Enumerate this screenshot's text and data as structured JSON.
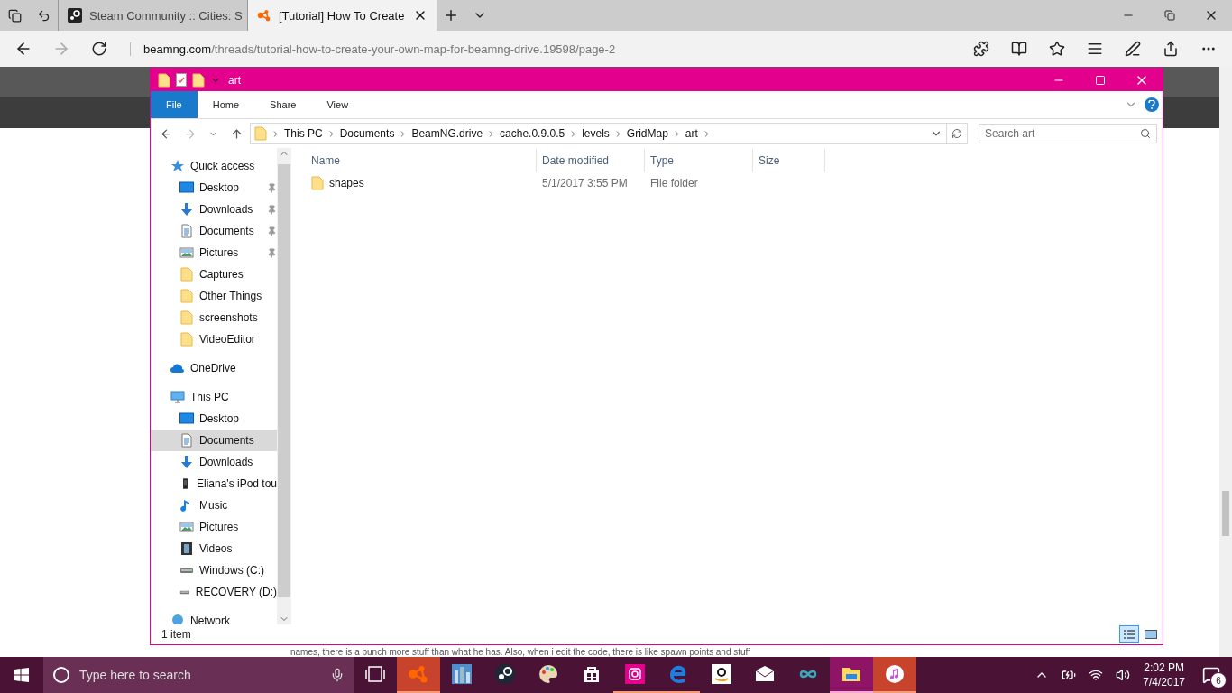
{
  "browser": {
    "tabs": [
      {
        "kind": "steam",
        "title": "Steam Community :: Cities: S",
        "selected": false
      },
      {
        "kind": "beamng",
        "title": "[Tutorial] How To Create",
        "selected": true
      }
    ],
    "url_host": "beamng.com",
    "url_path": "/threads/tutorial-how-to-create-your-own-map-for-beamng-drive.19598/page-2",
    "page_text": "names, there is a bunch more stuff than what he has. Also, when i edit the code, there is like spawn points and stuff"
  },
  "explorer": {
    "title": "art",
    "ribbon_tabs": [
      {
        "label": "File",
        "kind": "file"
      },
      {
        "label": "Home",
        "kind": "tab"
      },
      {
        "label": "Share",
        "kind": "tab"
      },
      {
        "label": "View",
        "kind": "tab"
      }
    ],
    "breadcrumbs": [
      "This PC",
      "Documents",
      "BeamNG.drive",
      "cache.0.9.0.5",
      "levels",
      "GridMap",
      "art"
    ],
    "search": {
      "placeholder": "Search art"
    },
    "nav": [
      {
        "label": "Quick access",
        "kind": "star",
        "selected": false,
        "children": [
          {
            "label": "Desktop",
            "kind": "desktop",
            "pinned": true,
            "selected": false
          },
          {
            "label": "Downloads",
            "kind": "download",
            "pinned": true,
            "selected": false
          },
          {
            "label": "Documents",
            "kind": "document",
            "pinned": true,
            "selected": false
          },
          {
            "label": "Pictures",
            "kind": "pictures",
            "pinned": true,
            "selected": false
          },
          {
            "label": "Captures",
            "kind": "folder",
            "pinned": false,
            "selected": false
          },
          {
            "label": "Other Things",
            "kind": "folder",
            "pinned": false,
            "selected": false
          },
          {
            "label": "screenshots",
            "kind": "folder",
            "pinned": false,
            "selected": false
          },
          {
            "label": "VideoEditor",
            "kind": "folder",
            "pinned": false,
            "selected": false
          }
        ]
      },
      {
        "label": "OneDrive",
        "kind": "cloud",
        "selected": false
      },
      {
        "label": "This PC",
        "kind": "pc",
        "selected": false,
        "children": [
          {
            "label": "Desktop",
            "kind": "desktop",
            "pinned": false,
            "selected": false
          },
          {
            "label": "Documents",
            "kind": "document",
            "pinned": false,
            "selected": true
          },
          {
            "label": "Downloads",
            "kind": "download",
            "pinned": false,
            "selected": false
          },
          {
            "label": "Eliana's iPod tou",
            "kind": "ipod",
            "pinned": false,
            "selected": false
          },
          {
            "label": "Music",
            "kind": "music",
            "pinned": false,
            "selected": false
          },
          {
            "label": "Pictures",
            "kind": "pictures",
            "pinned": false,
            "selected": false
          },
          {
            "label": "Videos",
            "kind": "videos",
            "pinned": false,
            "selected": false
          },
          {
            "label": "Windows (C:)",
            "kind": "drive",
            "pinned": false,
            "selected": false
          },
          {
            "label": "RECOVERY (D:)",
            "kind": "drive",
            "pinned": false,
            "selected": false
          }
        ]
      },
      {
        "label": "Network",
        "kind": "network",
        "selected": false
      }
    ],
    "columns": [
      "Name",
      "Date modified",
      "Type",
      "Size"
    ],
    "rows": [
      {
        "name": "shapes",
        "date": "5/1/2017 3:55 PM",
        "type": "File folder"
      }
    ],
    "status": "1 item",
    "views": [
      {
        "kind": "details",
        "selected": true
      },
      {
        "kind": "large",
        "selected": false
      }
    ]
  },
  "taskbar": {
    "search_placeholder": "Type here to search",
    "apps": [
      {
        "kind": "taskview",
        "running": false,
        "focused": false
      },
      {
        "kind": "beamng",
        "running": true,
        "focused": false
      },
      {
        "kind": "cities",
        "running": false,
        "focused": false
      },
      {
        "kind": "steam",
        "running": false,
        "focused": false
      },
      {
        "kind": "paint",
        "running": false,
        "focused": false
      },
      {
        "kind": "store",
        "running": false,
        "focused": false
      },
      {
        "kind": "instagram",
        "running": true,
        "focused": false
      },
      {
        "kind": "edge",
        "running": true,
        "focused": false
      },
      {
        "kind": "amazon",
        "running": false,
        "focused": false
      },
      {
        "kind": "mail",
        "running": false,
        "focused": false
      },
      {
        "kind": "infinity",
        "running": false,
        "focused": false
      },
      {
        "kind": "explorer",
        "running": true,
        "focused": true
      },
      {
        "kind": "itunes",
        "running": true,
        "focused": false
      }
    ],
    "time": "2:02 PM",
    "date": "7/4/2017",
    "notifications": "6"
  }
}
